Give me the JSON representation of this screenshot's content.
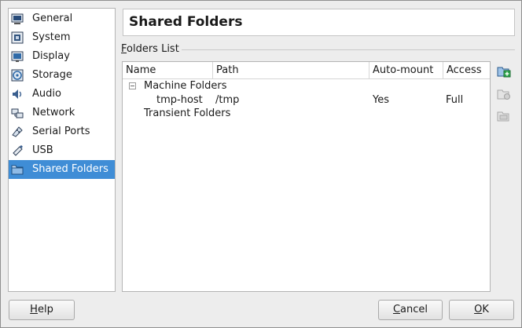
{
  "sidebar": {
    "items": [
      {
        "label": "General",
        "icon": "general-icon"
      },
      {
        "label": "System",
        "icon": "system-icon"
      },
      {
        "label": "Display",
        "icon": "display-icon"
      },
      {
        "label": "Storage",
        "icon": "storage-icon"
      },
      {
        "label": "Audio",
        "icon": "audio-icon"
      },
      {
        "label": "Network",
        "icon": "network-icon"
      },
      {
        "label": "Serial Ports",
        "icon": "serial-ports-icon"
      },
      {
        "label": "USB",
        "icon": "usb-icon"
      },
      {
        "label": "Shared Folders",
        "icon": "shared-folders-icon",
        "selected": true
      }
    ]
  },
  "header": {
    "title": "Shared Folders"
  },
  "folders_list": {
    "group_label_accel": "F",
    "group_label_rest": "olders List",
    "columns": [
      "Name",
      "Path",
      "Auto-mount",
      "Access"
    ],
    "groups": [
      {
        "name": "Machine Folders",
        "expanded": true,
        "rows": [
          {
            "name": "tmp-host",
            "path": "/tmp",
            "auto_mount": "Yes",
            "access": "Full"
          }
        ]
      },
      {
        "name": "Transient Folders",
        "rows": []
      }
    ]
  },
  "tools": [
    "add-folder-icon",
    "edit-folder-icon",
    "remove-folder-icon"
  ],
  "buttons": {
    "help_accel": "H",
    "help_rest": "elp",
    "cancel_accel": "C",
    "cancel_rest": "ancel",
    "ok_accel": "O",
    "ok_rest": "K"
  },
  "colors": {
    "selection": "#3f8dd6",
    "window_bg": "#ededed"
  }
}
